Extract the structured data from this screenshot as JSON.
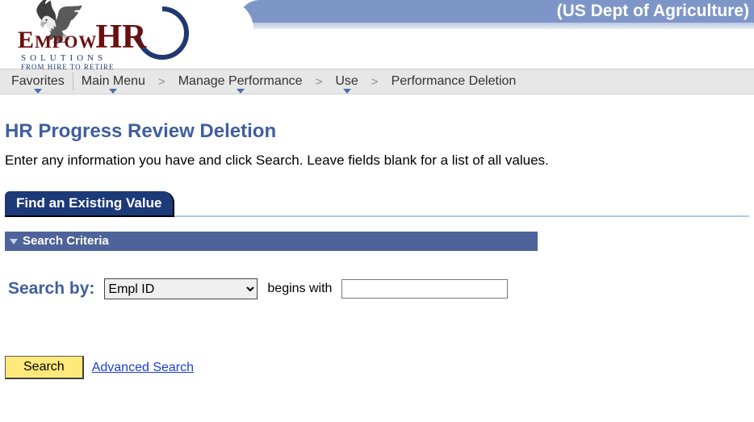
{
  "banner": {
    "org": "(US Dept of Agriculture)"
  },
  "logo": {
    "brand_a": "E",
    "brand_b": "MPOW",
    "brand_c": "HR",
    "sub": "SOLUTIONS",
    "tag": "FROM HIRE TO RETIRE"
  },
  "breadcrumb": {
    "favorites": "Favorites",
    "main_menu": "Main Menu",
    "manage_perf": "Manage Performance",
    "use": "Use",
    "current": "Performance Deletion"
  },
  "page": {
    "title": "HR Progress Review Deletion",
    "instructions": "Enter any information you have and click Search. Leave fields blank for a list of all values."
  },
  "tab": {
    "label": "Find an Existing Value"
  },
  "criteria": {
    "header": "Search Criteria",
    "search_by_label": "Search by:",
    "field_option": "Empl ID",
    "operator": "begins with",
    "value": ""
  },
  "actions": {
    "search": "Search",
    "advanced": "Advanced Search"
  }
}
